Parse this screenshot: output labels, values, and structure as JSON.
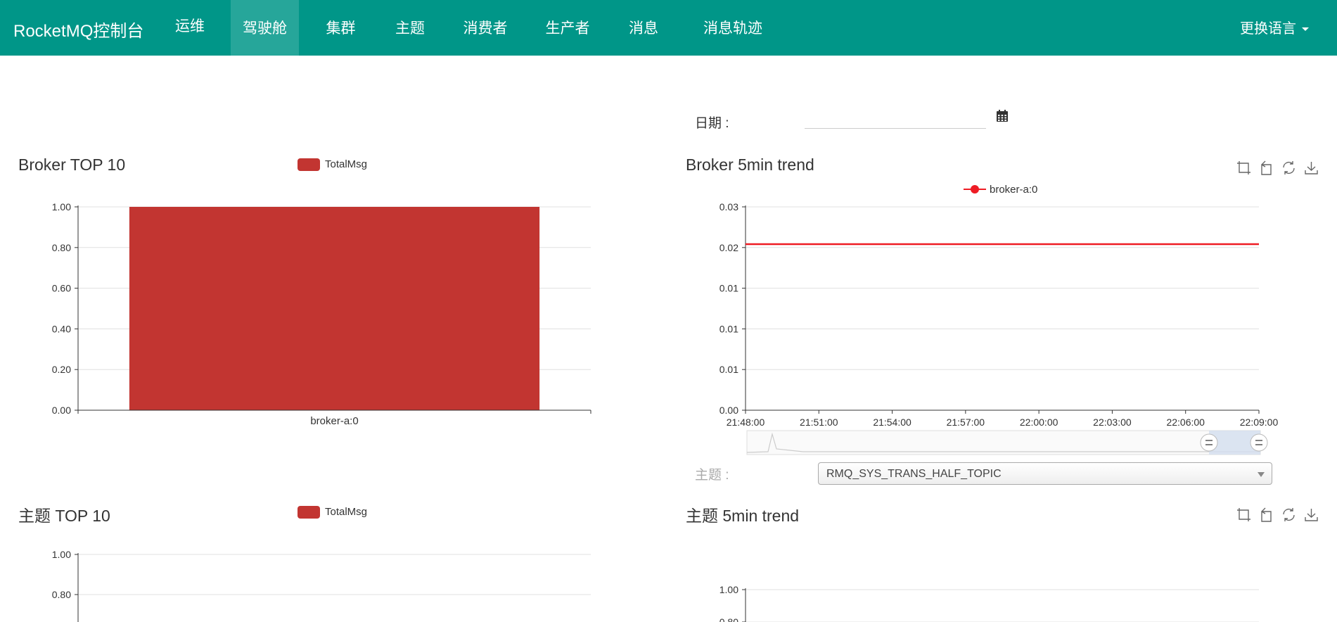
{
  "nav": {
    "brand": "RocketMQ控制台",
    "items": [
      "运维",
      "驾驶舱",
      "集群",
      "主题",
      "消费者",
      "生产者",
      "消息",
      "消息轨迹"
    ],
    "active": "驾驶舱",
    "language": "更换语言"
  },
  "date": {
    "label": "日期 :",
    "value": ""
  },
  "topic_selector": {
    "label": "主题 :",
    "selected": "RMQ_SYS_TRANS_HALF_TOPIC"
  },
  "panels": {
    "broker_top": {
      "title": "Broker TOP 10",
      "legend": "TotalMsg"
    },
    "broker_trend": {
      "title": "Broker 5min trend",
      "legend": "broker-a:0"
    },
    "topic_top": {
      "title": "主题 TOP 10",
      "legend": "TotalMsg"
    },
    "topic_trend": {
      "title": "主题 5min trend"
    }
  },
  "colors": {
    "navbar": "#009688",
    "nav_active": "#26a69a",
    "bar": "#c23531",
    "line": "#ee1c24"
  },
  "icons": [
    "zoom-icon",
    "zoom-reset-icon",
    "restore-icon",
    "download-icon"
  ],
  "chart_data": [
    {
      "type": "bar",
      "title": "Broker TOP 10",
      "categories": [
        "broker-a:0"
      ],
      "series": [
        {
          "name": "TotalMsg",
          "values": [
            1.0
          ]
        }
      ],
      "y_ticks": [
        "0.00",
        "0.20",
        "0.40",
        "0.60",
        "0.80",
        "1.00"
      ],
      "ylim": [
        0,
        1
      ],
      "grid": true,
      "legend": "top"
    },
    {
      "type": "line",
      "title": "Broker 5min trend",
      "x": [
        "21:48:00",
        "21:51:00",
        "21:54:00",
        "21:57:00",
        "22:00:00",
        "22:03:00",
        "22:06:00",
        "22:09:00"
      ],
      "series": [
        {
          "name": "broker-a:0",
          "values": [
            0.0245,
            0.0245,
            0.0245,
            0.0245,
            0.0245,
            0.0245,
            0.0245,
            0.0245
          ]
        }
      ],
      "y_ticks": [
        "0.00",
        "0.01",
        "0.01",
        "0.01",
        "0.02",
        "0.03"
      ],
      "ylim": [
        0,
        0.03
      ],
      "grid": true,
      "legend": "top",
      "data_zoom": {
        "start": 0.9,
        "end": 1.0
      }
    },
    {
      "type": "bar",
      "title": "主题 TOP 10",
      "categories": [],
      "series": [
        {
          "name": "TotalMsg",
          "values": []
        }
      ],
      "y_ticks": [
        "0.80",
        "1.00"
      ],
      "ylim": [
        0,
        1
      ],
      "grid": true,
      "legend": "top"
    },
    {
      "type": "line",
      "title": "主题 5min trend",
      "x": [],
      "series": [],
      "y_ticks": [
        "0.80",
        "1.00"
      ],
      "ylim": [
        0,
        1
      ],
      "grid": true
    }
  ]
}
